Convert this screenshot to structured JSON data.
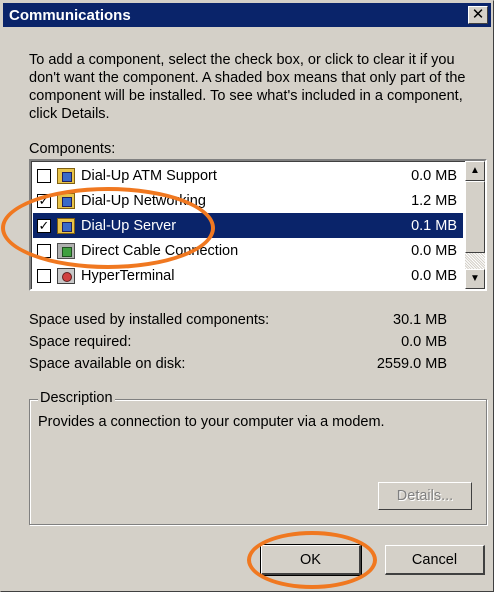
{
  "window": {
    "title": "Communications",
    "close_glyph": "✕"
  },
  "intro_text": "To add a component, select the check box, or click to clear it if you don't want the component. A shaded box means that only part of the component will be installed. To see what's included in a component, click Details.",
  "components_label": "Components:",
  "components": [
    {
      "name": "Dial-Up ATM Support",
      "size": "0.0 MB",
      "checked": false,
      "selected": false,
      "icon": "component-icon"
    },
    {
      "name": "Dial-Up Networking",
      "size": "1.2 MB",
      "checked": true,
      "selected": false,
      "icon": "component-icon"
    },
    {
      "name": "Dial-Up Server",
      "size": "0.1 MB",
      "checked": true,
      "selected": true,
      "icon": "component-icon"
    },
    {
      "name": "Direct Cable Connection",
      "size": "0.0 MB",
      "checked": false,
      "selected": false,
      "icon": "cable-icon"
    },
    {
      "name": "HyperTerminal",
      "size": "0.0 MB",
      "checked": false,
      "selected": false,
      "icon": "terminal-icon"
    }
  ],
  "space": {
    "used_label": "Space used by installed components:",
    "used_value": "30.1 MB",
    "required_label": "Space required:",
    "required_value": "0.0 MB",
    "available_label": "Space available on disk:",
    "available_value": "2559.0 MB"
  },
  "description": {
    "title": "Description",
    "text": "Provides a connection to your computer via a modem.",
    "details_label": "Details..."
  },
  "buttons": {
    "ok": "OK",
    "cancel": "Cancel"
  },
  "annotation_color": "#f07820",
  "selection_color": "#0a246a"
}
